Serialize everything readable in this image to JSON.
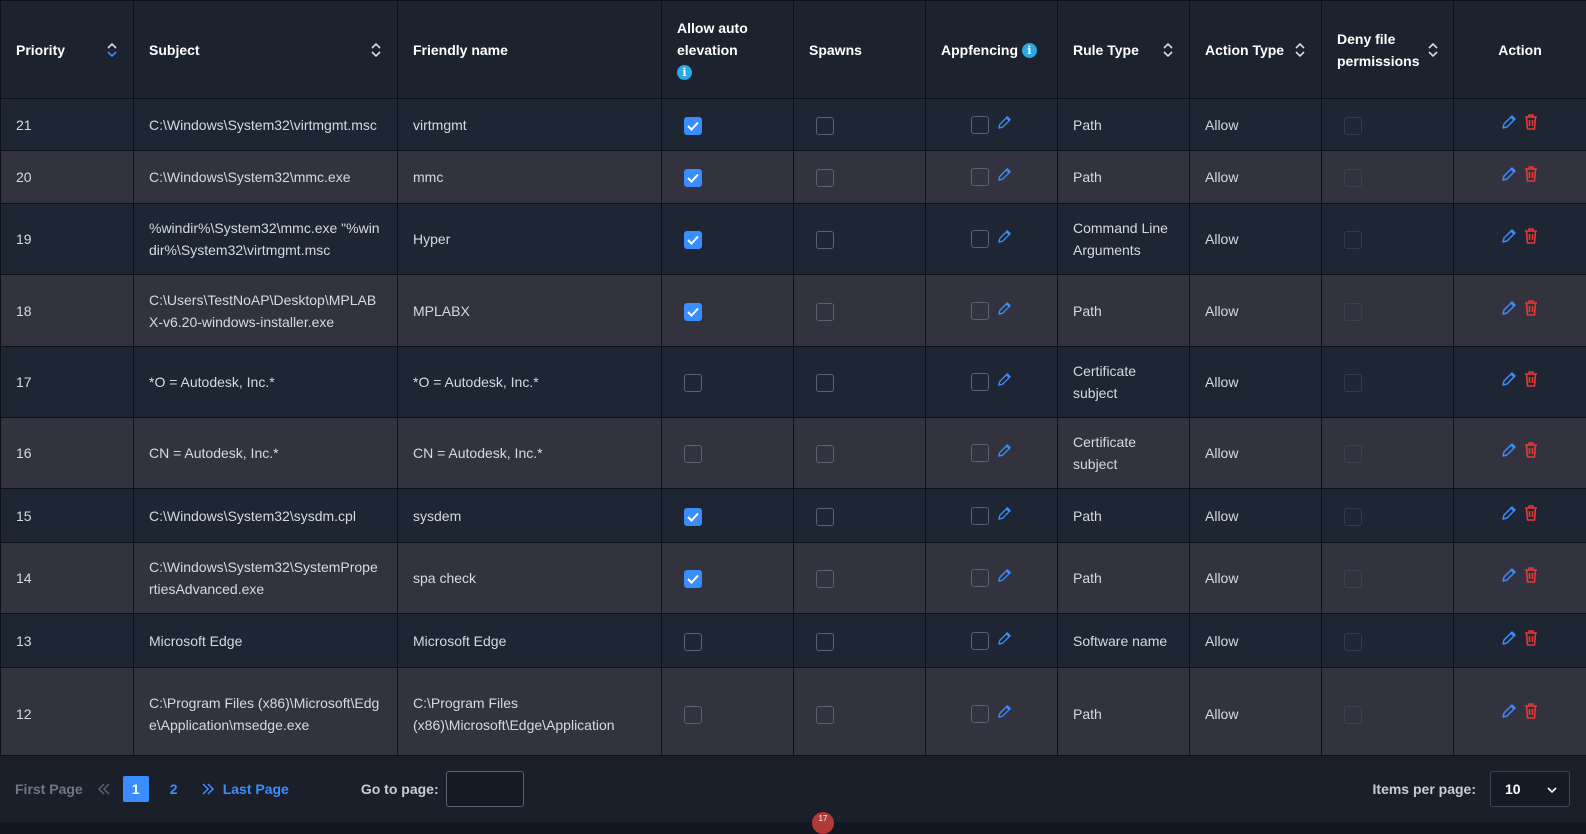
{
  "headers": {
    "priority": "Priority",
    "subject": "Subject",
    "friendly_name": "Friendly name",
    "allow_auto_elevation": "Allow auto elevation",
    "spawns": "Spawns",
    "appfencing": "Appfencing",
    "rule_type": "Rule Type",
    "action_type": "Action Type",
    "deny_file_permissions": "Deny file permissions",
    "action": "Action"
  },
  "rows": [
    {
      "priority": "21",
      "subject": "C:\\Windows\\System32\\virtmgmt.msc",
      "friendly_name": "virtmgmt",
      "auto_elevation": true,
      "rule_type": "Path",
      "action_type": "Allow"
    },
    {
      "priority": "20",
      "subject": "C:\\Windows\\System32\\mmc.exe",
      "friendly_name": "mmc",
      "auto_elevation": true,
      "rule_type": "Path",
      "action_type": "Allow"
    },
    {
      "priority": "19",
      "subject": "%windir%\\System32\\mmc.exe \"%windir%\\System32\\virtmgmt.msc",
      "friendly_name": "Hyper",
      "auto_elevation": true,
      "rule_type": "Command Line Arguments",
      "action_type": "Allow"
    },
    {
      "priority": "18",
      "subject": "C:\\Users\\TestNoAP\\Desktop\\MPLAB X-v6.20-windows-installer.exe",
      "friendly_name": "MPLABX",
      "auto_elevation": true,
      "rule_type": "Path",
      "action_type": "Allow"
    },
    {
      "priority": "17",
      "subject": "*O = Autodesk, Inc.*",
      "friendly_name": "*O = Autodesk, Inc.*",
      "auto_elevation": false,
      "rule_type": "Certificate subject",
      "action_type": "Allow"
    },
    {
      "priority": "16",
      "subject": "CN = Autodesk, Inc.*",
      "friendly_name": "CN = Autodesk, Inc.*",
      "auto_elevation": false,
      "rule_type": "Certificate subject",
      "action_type": "Allow"
    },
    {
      "priority": "15",
      "subject": "C:\\Windows\\System32\\sysdm.cpl",
      "friendly_name": "sysdem",
      "auto_elevation": true,
      "rule_type": "Path",
      "action_type": "Allow"
    },
    {
      "priority": "14",
      "subject": "C:\\Windows\\System32\\SystemPropertiesAdvanced.exe",
      "friendly_name": "spa check",
      "auto_elevation": true,
      "rule_type": "Path",
      "action_type": "Allow"
    },
    {
      "priority": "13",
      "subject": "Microsoft Edge",
      "friendly_name": "Microsoft Edge",
      "auto_elevation": false,
      "rule_type": "Software name",
      "action_type": "Allow"
    },
    {
      "priority": "12",
      "subject": "C:\\Program Files (x86)\\Microsoft\\Edge\\Application\\msedge.exe",
      "friendly_name": "C:\\Program Files (x86)\\Microsoft\\Edge\\Application",
      "auto_elevation": false,
      "rule_type": "Path",
      "action_type": "Allow"
    }
  ],
  "pagination": {
    "first_page": "First Page",
    "pages": [
      "1",
      "2"
    ],
    "current_page": "1",
    "last_page": "Last Page",
    "goto_label": "Go to page:",
    "goto_value": "",
    "items_per_page_label": "Items per page:",
    "items_per_page_value": "10"
  },
  "notification_badge": "17",
  "colors": {
    "accent": "#3a8dff",
    "delete": "#e53935",
    "info": "#29a9e6",
    "row_odd": "#1e2533",
    "row_even": "#333340",
    "header_bg": "#1c222e"
  },
  "icons": {
    "edit": "pencil-icon",
    "delete": "trash-icon",
    "info": "info-icon",
    "sort": "sort-icon"
  }
}
